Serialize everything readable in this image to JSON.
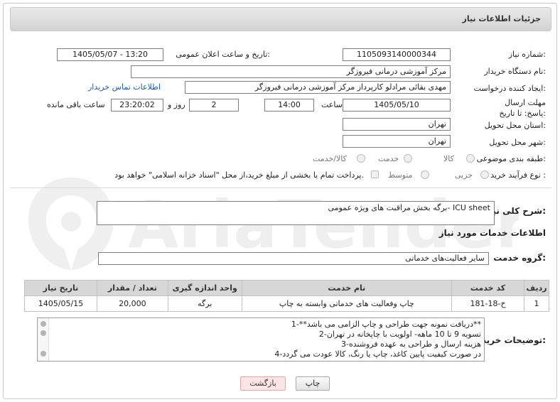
{
  "header": {
    "title": "جزئیات اطلاعات نیاز"
  },
  "fields": {
    "need_number_label": "شماره نیاز:",
    "need_number": "1105093140000344",
    "announce_label": "تاریخ و ساعت اعلان عمومی:",
    "announce_value": "1405/05/07 - 13:20",
    "buyer_org_label": "نام دستگاه خریدار:",
    "buyer_org": "مرکز آموزشی درمانی فیروزگر",
    "creator_label": "ایجاد کننده درخواست:",
    "creator": "مهدی بقائی مرادلو کارپرداز مرکز آموزشی درمانی فیروزگر",
    "contact_link": "اطلاعات تماس خریدار",
    "deadline_label": "مهلت ارسال پاسخ: تا تاریخ:",
    "deadline_date": "1405/05/10",
    "time_label": "ساعت",
    "deadline_time": "14:00",
    "days_value": "2",
    "days_label": "روز و",
    "remaining_time": "23:20:02",
    "remaining_label": "ساعت باقی مانده",
    "province_label": "استان محل تحویل:",
    "province": "تهران",
    "city_label": "شهر محل تحویل:",
    "city": "تهران",
    "category_label": "طبقه بندی موضوعی:",
    "category_options": [
      "کالا",
      "خدمت",
      "کالا/خدمت"
    ],
    "purchase_type_label": "نوع فرآیند خرید :",
    "purchase_type_options": [
      "جزیی",
      "متوسط"
    ],
    "payment_note": "پرداخت تمام یا بخشی از مبلغ خرید،از محل \"اسناد خزانه اسلامی\" خواهد بود."
  },
  "description": {
    "label": "شرح کلی نیاز:",
    "value": "برگه بخش مراقبت های ویژه عمومی-  ICU sheet"
  },
  "services_section": {
    "title": "اطلاعات خدمات مورد نیاز",
    "group_label": "گروه خدمت:",
    "group_value": "سایر فعالیت‌های خدماتی"
  },
  "table": {
    "headers": [
      "ردیف",
      "کد خدمت",
      "نام خدمت",
      "واحد اندازه گیری",
      "تعداد / مقدار",
      "تاریخ نیاز"
    ],
    "rows": [
      [
        "1",
        "خ-18-181",
        "چاپ وفعالیت های خدماتی وابسته به چاپ",
        "برگه",
        "20,000",
        "1405/05/15"
      ]
    ]
  },
  "notes": {
    "label": "توضیحات خریدار:",
    "lines": [
      "1-**دریافت نمونه جهت طراحی و چاپ الزامی می باشد**",
      "2-تسویه 9 تا 10 ماهه- اولویت با چاپخانه در تهران",
      "3-هزینه ارسال و طراحی به عهده فروشنده",
      "4-در صورت کیفیت پایین کاغذ، چاپ یا رنگ، کالا عودت می گردد"
    ]
  },
  "buttons": {
    "print": "چاپ",
    "back": "بازگشت"
  },
  "watermark": {
    "text": "AriaTender.net"
  }
}
